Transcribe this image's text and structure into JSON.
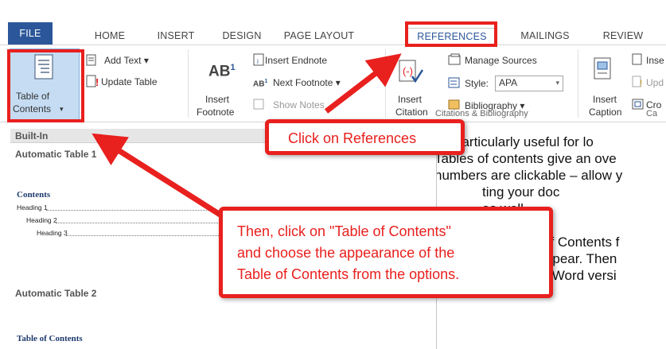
{
  "tabs": [
    "FILE",
    "HOME",
    "INSERT",
    "DESIGN",
    "PAGE LAYOUT",
    "REFERENCES",
    "MAILINGS",
    "REVIEW"
  ],
  "ribbon": {
    "toc_label_1": "Table of",
    "toc_label_2": "Contents",
    "toc_caret": "▾",
    "add_text": "Add Text",
    "update_table": "Update Table",
    "insert_footnote_1": "Insert",
    "insert_footnote_2": "Footnote",
    "insert_endnote": "Insert Endnote",
    "next_footnote": "Next Footnote",
    "show_notes": "Show Notes",
    "insert_citation_1": "Insert",
    "insert_citation_2": "Citation",
    "manage_sources": "Manage Sources",
    "style_label": "Style:",
    "style_value": "APA",
    "bibliography": "Bibliography",
    "group_citations": "Citations & Bibliography",
    "insert_caption_1": "Insert",
    "insert_caption_2": "Caption",
    "insert_tof": "Inse",
    "update_table_2": "Upd",
    "cross_ref": "Cro",
    "group_captions": "Ca"
  },
  "gallery": {
    "header": "Built-In",
    "auto1_title": "Automatic Table 1",
    "auto1_heading": "Contents",
    "heading1": "Heading 1",
    "heading2": "Heading 2",
    "heading3": "Heading 3",
    "auto2_title": "Automatic Table 2",
    "auto2_heading": "Table of Contents"
  },
  "document": {
    "lines": [
      "",
      "is particularly useful for lo",
      "Tables of contents give an ove",
      "numbers are clickable – allow y",
      "ting your doc",
      "as well.",
      "",
      "of Contents f",
      "want the table to appear. Then",
      "Elements\" (in older Word versi"
    ]
  },
  "callouts": {
    "references": "Click on References",
    "toc_line1": "Then, click on \"Table of Contents\"",
    "toc_line2": "and choose the appearance of the",
    "toc_line3": "Table of Contents from the options."
  },
  "colors": {
    "accent": "#2b579a",
    "callout": "#e8201e"
  }
}
